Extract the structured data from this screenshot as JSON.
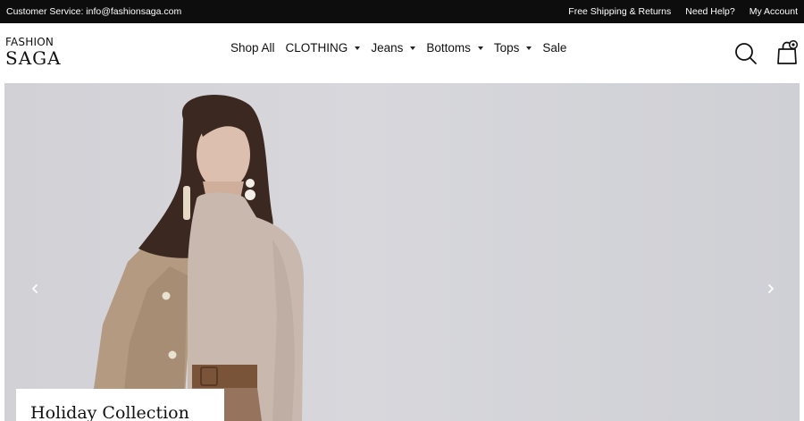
{
  "topbar": {
    "customer_service": "Customer Service: info@fashionsaga.com",
    "links": [
      "Free Shipping & Returns",
      "Need Help?",
      "My Account"
    ]
  },
  "logo": {
    "line1": "FASHION",
    "line2": "SAGA"
  },
  "nav": {
    "items": [
      {
        "label": "Shop All",
        "has_dropdown": false
      },
      {
        "label": "CLOTHING",
        "has_dropdown": true
      },
      {
        "label": "Jeans",
        "has_dropdown": true
      },
      {
        "label": "Bottoms",
        "has_dropdown": true
      },
      {
        "label": "Tops",
        "has_dropdown": true
      },
      {
        "label": "Sale",
        "has_dropdown": false
      }
    ]
  },
  "icons": {
    "search": "search-icon",
    "cart": "shopping-bag-icon",
    "prev": "chevron-left-icon",
    "next": "chevron-right-icon"
  },
  "hero": {
    "caption_title": "Holiday Collection"
  },
  "colors": {
    "topbar_bg": "#0d0d0d",
    "hero_bg": "#d3d3d8",
    "text": "#111111"
  }
}
